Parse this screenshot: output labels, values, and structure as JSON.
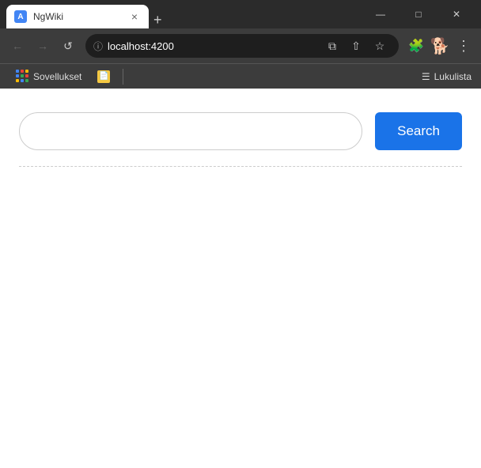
{
  "titleBar": {
    "tab": {
      "favicon": "A",
      "title": "NgWiki",
      "closeLabel": "×"
    },
    "newTabLabel": "+",
    "windowControls": {
      "minimize": "—",
      "maximize": "□",
      "close": "✕"
    }
  },
  "addressBar": {
    "back": "←",
    "forward": "→",
    "reload": "↺",
    "url": "localhost:4200",
    "secureIcon": "ⓘ",
    "openExternal": "⧉",
    "share": "⇧",
    "bookmark": "☆",
    "puzzle": "🧩",
    "dog": "🐕",
    "menu": "⋮"
  },
  "bookmarksBar": {
    "sovellukset": "Sovellukset",
    "noteIcon": "📄",
    "separator": "|",
    "readingListIcon": "☰",
    "readingList": "Lukulista"
  },
  "page": {
    "searchInput": {
      "placeholder": "",
      "value": ""
    },
    "searchButton": "Search"
  }
}
